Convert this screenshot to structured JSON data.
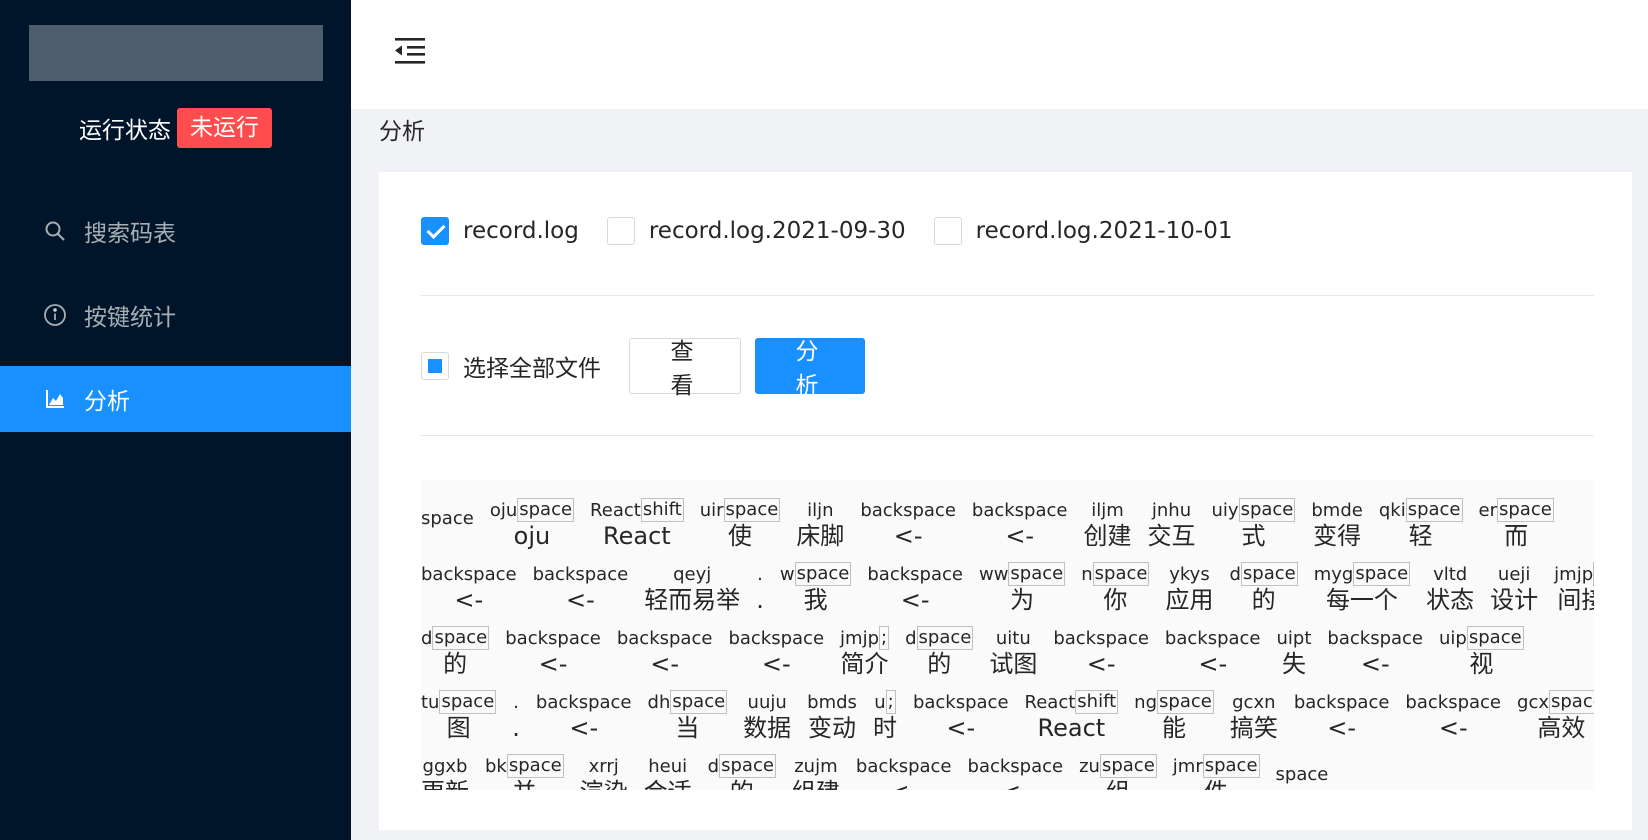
{
  "sidebar": {
    "status_label": "运行状态",
    "status_badge": "未运行",
    "status_color": "#ff4d4f",
    "items": [
      {
        "label": "搜索码表",
        "icon": "search-icon"
      },
      {
        "label": "按键统计",
        "icon": "info-circle-icon"
      },
      {
        "label": "分析",
        "icon": "area-chart-icon",
        "active": true
      }
    ]
  },
  "header": {
    "icon": "menu-fold-icon"
  },
  "page": {
    "title": "分析"
  },
  "files": [
    {
      "label": "record.log",
      "checked": true
    },
    {
      "label": "record.log.2021-09-30",
      "checked": false
    },
    {
      "label": "record.log.2021-10-01",
      "checked": false
    }
  ],
  "select_all": {
    "label": "选择全部文件",
    "state": "indeterminate"
  },
  "buttons": {
    "view": "查看",
    "analyze": "分析"
  },
  "colors": {
    "primary": "#1890ff",
    "sidebar_bg": "#001529"
  },
  "result": {
    "lines": [
      [
        [
          "space",
          ""
        ],
        [
          "oju|space",
          "oju"
        ],
        [
          "React|shift",
          "React"
        ],
        [
          "uir|space",
          "使"
        ],
        [
          "iljn",
          "床脚"
        ],
        [
          "backspace",
          "<-"
        ],
        [
          "backspace",
          "<-"
        ],
        [
          "iljm",
          "创建"
        ],
        [
          "jnhu",
          "交互"
        ],
        [
          "uiy|space",
          "式"
        ],
        [
          "bmde",
          "变得"
        ],
        [
          "qki|space",
          "轻"
        ],
        [
          "er|space",
          "而"
        ]
      ],
      [
        [
          "backspace",
          "<-"
        ],
        [
          "backspace",
          "<-"
        ],
        [
          "qeyj",
          "轻而易举"
        ],
        [
          ".",
          "."
        ],
        [
          "w|space",
          "我"
        ],
        [
          "backspace",
          "<-"
        ],
        [
          "ww|space",
          "为"
        ],
        [
          "n|space",
          "你"
        ],
        [
          "ykys",
          "应用"
        ],
        [
          "d|space",
          "的"
        ],
        [
          "myg|space",
          "每一个"
        ],
        [
          "vltd",
          "状态"
        ],
        [
          "ueji",
          "设计"
        ],
        [
          "jmjp|d",
          "间接"
        ]
      ],
      [
        [
          "d|space",
          "的"
        ],
        [
          "backspace",
          "<-"
        ],
        [
          "backspace",
          "<-"
        ],
        [
          "backspace",
          "<-"
        ],
        [
          "jmjp|;",
          "简介"
        ],
        [
          "d|space",
          "的"
        ],
        [
          "uitu",
          "试图"
        ],
        [
          "backspace",
          "<-"
        ],
        [
          "backspace",
          "<-"
        ],
        [
          "uipt",
          "失"
        ],
        [
          "backspace",
          "<-"
        ],
        [
          "uip|space",
          "视"
        ]
      ],
      [
        [
          "tu|space",
          "图"
        ],
        [
          ".",
          "."
        ],
        [
          "backspace",
          "<-"
        ],
        [
          "dh|space",
          "当"
        ],
        [
          "uuju",
          "数据"
        ],
        [
          "bmds",
          "变动"
        ],
        [
          "u|;",
          "时"
        ],
        [
          "backspace",
          "<-"
        ],
        [
          "React|shift",
          "React"
        ],
        [
          "ng|space",
          "能"
        ],
        [
          "gcxn",
          "搞笑"
        ],
        [
          "backspace",
          "<-"
        ],
        [
          "backspace",
          "<-"
        ],
        [
          "gcx|space",
          "高效"
        ]
      ],
      [
        [
          "ggxb",
          "更新"
        ],
        [
          "bk|space",
          "并"
        ],
        [
          "xrrj",
          "渲染"
        ],
        [
          "heui",
          "合适"
        ],
        [
          "d|space",
          "的"
        ],
        [
          "zujm",
          "组建"
        ],
        [
          "backspace",
          "<-"
        ],
        [
          "backspace",
          "<-"
        ],
        [
          "zu|space",
          "组"
        ],
        [
          "jmr|space",
          "件"
        ],
        [
          "space",
          ""
        ]
      ]
    ]
  }
}
